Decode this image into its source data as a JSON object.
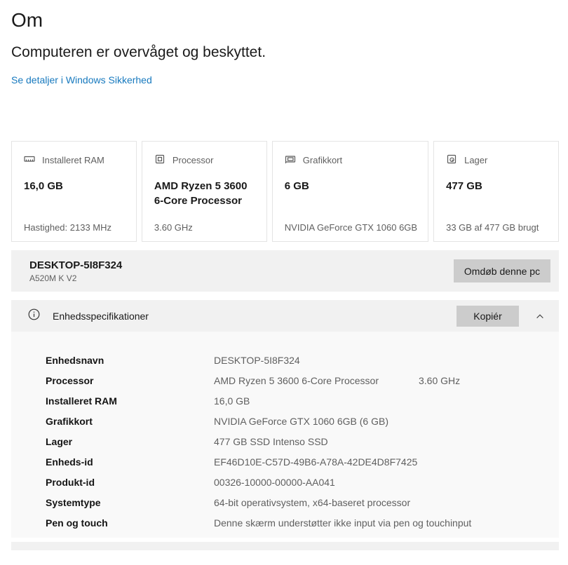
{
  "page": {
    "title": "Om",
    "subtitle": "Computeren er overvåget og beskyttet.",
    "security_link": "Se detaljer i Windows Sikkerhed"
  },
  "cards": [
    {
      "icon": "ram-icon",
      "label": "Installeret RAM",
      "value": "16,0 GB",
      "detail": "Hastighed: 2133 MHz"
    },
    {
      "icon": "cpu-icon",
      "label": "Processor",
      "value": "AMD Ryzen 5 3600 6-Core Processor",
      "detail": "3.60 GHz"
    },
    {
      "icon": "gpu-icon",
      "label": "Grafikkort",
      "value": "6 GB",
      "detail": "NVIDIA GeForce GTX 1060 6GB"
    },
    {
      "icon": "storage-icon",
      "label": "Lager",
      "value": "477 GB",
      "detail": "33 GB af 477 GB brugt"
    }
  ],
  "device_bar": {
    "name": "DESKTOP-5I8F324",
    "model": "A520M K V2",
    "rename_button": "Omdøb denne pc"
  },
  "spec_section": {
    "title": "Enhedsspecifikationer",
    "copy_button": "Kopiér",
    "rows": [
      {
        "label": "Enhedsnavn",
        "value": "DESKTOP-5I8F324",
        "extra": ""
      },
      {
        "label": "Processor",
        "value": "AMD Ryzen 5 3600 6-Core Processor",
        "extra": "3.60 GHz"
      },
      {
        "label": "Installeret RAM",
        "value": "16,0 GB",
        "extra": ""
      },
      {
        "label": "Grafikkort",
        "value": "NVIDIA GeForce GTX 1060 6GB (6 GB)",
        "extra": ""
      },
      {
        "label": "Lager",
        "value": "477 GB SSD Intenso SSD",
        "extra": ""
      },
      {
        "label": "Enheds-id",
        "value": "EF46D10E-C57D-49B6-A78A-42DE4D8F7425",
        "extra": ""
      },
      {
        "label": "Produkt-id",
        "value": "00326-10000-00000-AA041",
        "extra": ""
      },
      {
        "label": "Systemtype",
        "value": "64-bit operativsystem, x64-baseret processor",
        "extra": ""
      },
      {
        "label": "Pen og touch",
        "value": "Denne skærm understøtter ikke input via pen og touchinput",
        "extra": ""
      }
    ]
  },
  "colors": {
    "link_blue": "#1779be",
    "bar_gray": "#f1f1f1",
    "body_gray": "#f9f9f9",
    "button_gray": "#cccccc",
    "card_border": "#e4e4e4",
    "text_secondary": "#5f5f5f"
  }
}
